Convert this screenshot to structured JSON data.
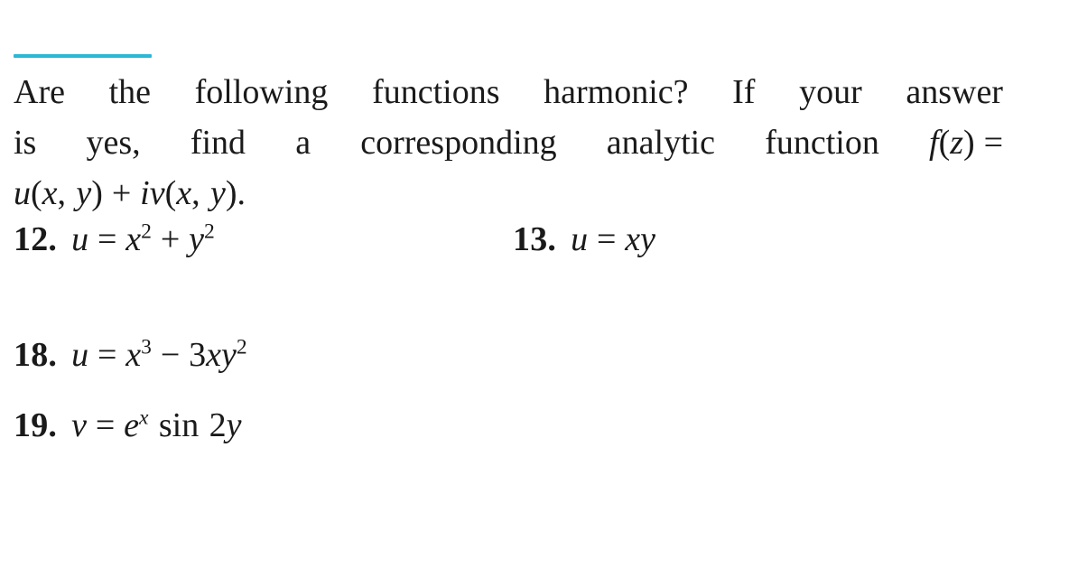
{
  "page": {
    "background_color": "#ffffff",
    "text_color": "#1a1a1a",
    "accent_color": "#2bb7d6"
  },
  "accent_rule": {
    "name": "highlight-rule",
    "color": "#2bb7d6"
  },
  "instructions": {
    "full_text": "Are the following functions harmonic? If your answer is yes, find a corresponding analytic function f(z) = u(x, y) + iv(x, y).",
    "line1": {
      "words": [
        "Are",
        "the",
        "following",
        "functions",
        "harmonic?",
        "If",
        "your",
        "answer"
      ]
    },
    "line2": {
      "words": [
        "is",
        "yes,",
        "find",
        "a",
        "corresponding",
        "analytic",
        "function"
      ],
      "math_tail": "f(z) ="
    },
    "line3": {
      "math": "u(x, y) + iv(x, y)."
    }
  },
  "exercises": [
    {
      "number": "12.",
      "expression": "u = x² + y²",
      "lhs": "u",
      "relation": "=",
      "rhs_terms": [
        {
          "base": "x",
          "exponent": "2"
        },
        {
          "operator": "+"
        },
        {
          "base": "y",
          "exponent": "2"
        }
      ],
      "column": "left",
      "row": 1
    },
    {
      "number": "13.",
      "expression": "u = xy",
      "lhs": "u",
      "relation": "=",
      "rhs_terms": [
        {
          "base": "xy",
          "exponent": ""
        }
      ],
      "column": "right",
      "row": 1
    },
    {
      "number": "18.",
      "expression": "u = x³ − 3xy²",
      "lhs": "u",
      "relation": "=",
      "rhs_terms": [
        {
          "base": "x",
          "exponent": "3"
        },
        {
          "operator": "−"
        },
        {
          "coefficient": "3",
          "base": "xy",
          "exponent": "2"
        }
      ],
      "column": "left",
      "row": 2
    },
    {
      "number": "19.",
      "expression": "v = eˣ sin 2y",
      "lhs": "v",
      "relation": "=",
      "rhs_terms": [
        {
          "base": "e",
          "exponent": "x",
          "exponent_italic": true
        },
        {
          "function": "sin"
        },
        {
          "coefficient": "2",
          "base": "y"
        }
      ],
      "column": "left",
      "row": 3
    }
  ],
  "symbols": {
    "equals": "=",
    "plus": "+",
    "minus": "−",
    "lparen": "(",
    "rparen": ")",
    "comma": ",",
    "period": ".",
    "var_u": "u",
    "var_v": "v",
    "var_x": "x",
    "var_y": "y",
    "var_z": "z",
    "var_f": "f",
    "var_i": "i",
    "var_e": "e",
    "fn_sin": "sin",
    "num_2": "2",
    "num_3": "3",
    "exp_2": "2",
    "exp_3": "3"
  }
}
